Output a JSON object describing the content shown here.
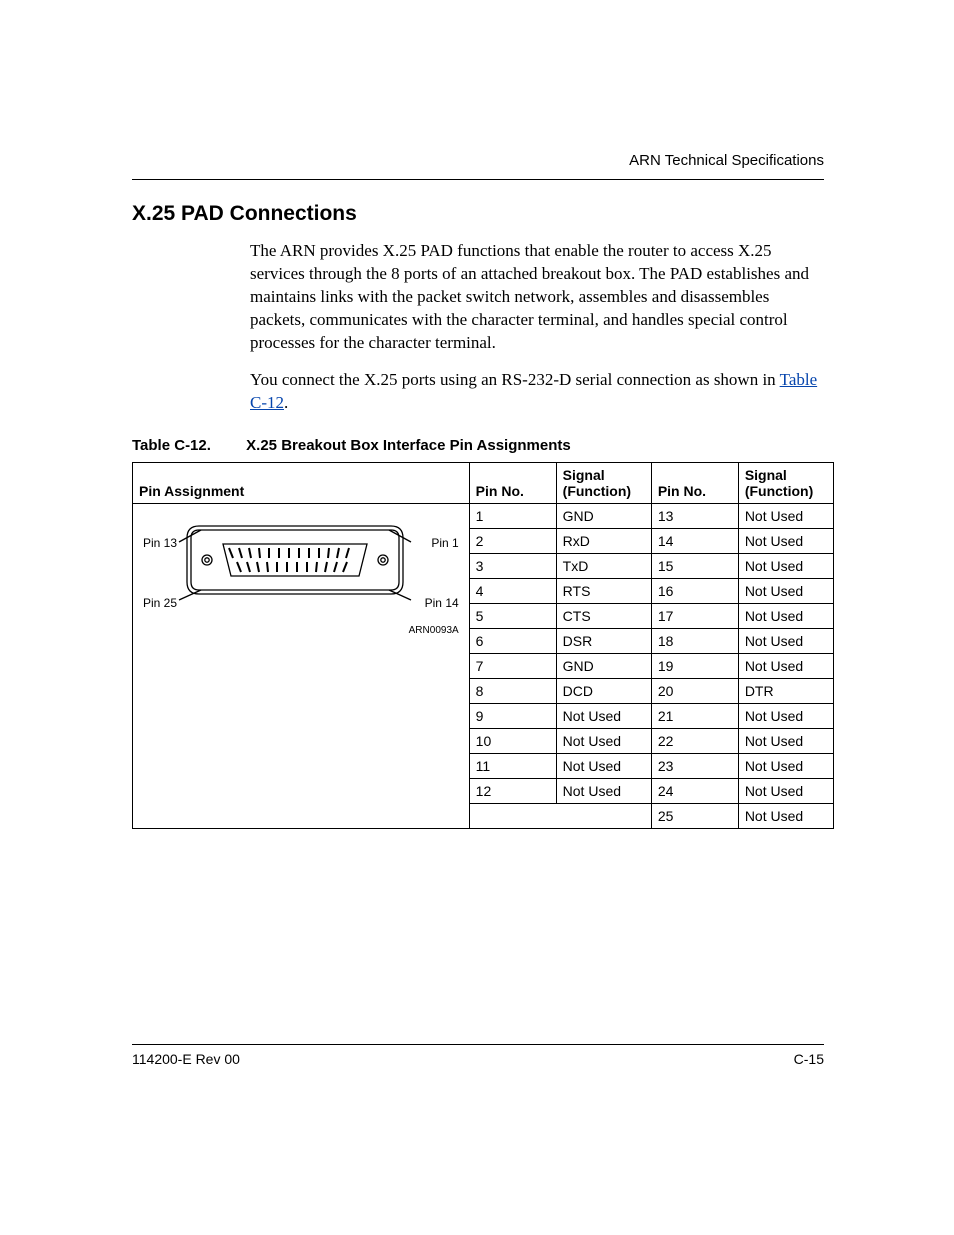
{
  "running_head": "ARN Technical Specifications",
  "section_title": "X.25 PAD Connections",
  "para1": "The ARN provides X.25 PAD functions that enable the router to access X.25 services through the 8 ports of an attached breakout box. The PAD establishes and maintains links with the packet switch network, assembles and disassembles packets, communicates with the character terminal, and handles special control processes for the character terminal.",
  "para2_prefix": "You connect the X.25 ports using an RS-232-D serial connection as shown in ",
  "para2_link": "Table C-12",
  "para2_suffix": ".",
  "table_number": "Table C-12.",
  "table_title": "X.25 Breakout Box Interface Pin Assignments",
  "headers": {
    "pa": "Pin Assignment",
    "pin_no": "Pin No.",
    "signal": "Signal\n(Function)"
  },
  "diagram": {
    "pin1": "Pin 1",
    "pin13": "Pin 13",
    "pin14": "Pin 14",
    "pin25": "Pin 25",
    "art_id": "ARN0093A"
  },
  "rows": [
    {
      "pin_a": "1",
      "sig_a": "GND",
      "pin_b": "13",
      "sig_b": "Not Used"
    },
    {
      "pin_a": "2",
      "sig_a": "RxD",
      "pin_b": "14",
      "sig_b": "Not Used"
    },
    {
      "pin_a": "3",
      "sig_a": "TxD",
      "pin_b": "15",
      "sig_b": "Not Used"
    },
    {
      "pin_a": "4",
      "sig_a": "RTS",
      "pin_b": "16",
      "sig_b": "Not Used"
    },
    {
      "pin_a": "5",
      "sig_a": "CTS",
      "pin_b": "17",
      "sig_b": "Not Used"
    },
    {
      "pin_a": "6",
      "sig_a": "DSR",
      "pin_b": "18",
      "sig_b": "Not Used"
    },
    {
      "pin_a": "7",
      "sig_a": "GND",
      "pin_b": "19",
      "sig_b": "Not Used"
    },
    {
      "pin_a": "8",
      "sig_a": "DCD",
      "pin_b": "20",
      "sig_b": "DTR"
    },
    {
      "pin_a": "9",
      "sig_a": "Not Used",
      "pin_b": "21",
      "sig_b": "Not Used"
    },
    {
      "pin_a": "10",
      "sig_a": "Not Used",
      "pin_b": "22",
      "sig_b": "Not Used"
    },
    {
      "pin_a": "11",
      "sig_a": "Not Used",
      "pin_b": "23",
      "sig_b": "Not Used"
    },
    {
      "pin_a": "12",
      "sig_a": "Not Used",
      "pin_b": "24",
      "sig_b": "Not Used"
    },
    {
      "pin_a": "",
      "sig_a": "",
      "pin_b": "25",
      "sig_b": "Not Used"
    }
  ],
  "footer": {
    "left": "114200-E Rev 00",
    "right": "C-15"
  },
  "chart_data": {
    "type": "table",
    "title": "X.25 Breakout Box Interface Pin Assignments",
    "columns": [
      "Pin No.",
      "Signal (Function)"
    ],
    "data": [
      [
        1,
        "GND"
      ],
      [
        2,
        "RxD"
      ],
      [
        3,
        "TxD"
      ],
      [
        4,
        "RTS"
      ],
      [
        5,
        "CTS"
      ],
      [
        6,
        "DSR"
      ],
      [
        7,
        "GND"
      ],
      [
        8,
        "DCD"
      ],
      [
        9,
        "Not Used"
      ],
      [
        10,
        "Not Used"
      ],
      [
        11,
        "Not Used"
      ],
      [
        12,
        "Not Used"
      ],
      [
        13,
        "Not Used"
      ],
      [
        14,
        "Not Used"
      ],
      [
        15,
        "Not Used"
      ],
      [
        16,
        "Not Used"
      ],
      [
        17,
        "Not Used"
      ],
      [
        18,
        "Not Used"
      ],
      [
        19,
        "Not Used"
      ],
      [
        20,
        "DTR"
      ],
      [
        21,
        "Not Used"
      ],
      [
        22,
        "Not Used"
      ],
      [
        23,
        "Not Used"
      ],
      [
        24,
        "Not Used"
      ],
      [
        25,
        "Not Used"
      ]
    ]
  }
}
